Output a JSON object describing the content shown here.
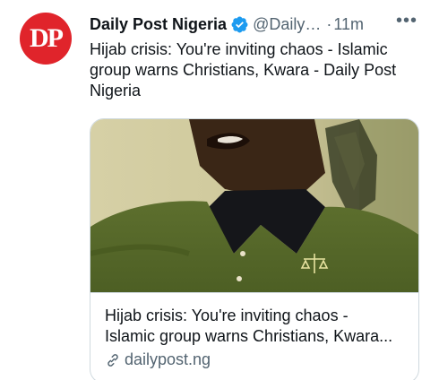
{
  "account": {
    "avatar_text": "DP",
    "display_name": "Daily Post Nigeria",
    "handle": "@Daily…",
    "separator": "·",
    "time": "11m",
    "more": "•••"
  },
  "tweet": {
    "text": "Hijab crisis: You're inviting chaos - Islamic group warns Christians, Kwara - Daily Post Nigeria"
  },
  "card": {
    "title_line1": "Hijab crisis: You're inviting chaos -",
    "title_line2": "Islamic group warns Christians, Kwara...",
    "domain": "dailypost.ng"
  },
  "colors": {
    "brand_red": "#e0242b",
    "verified_blue": "#1d9bf0",
    "secondary_text": "#536471",
    "border": "#cfd9de"
  },
  "icons": {
    "verified": "verified-badge-icon",
    "link": "link-icon",
    "more": "more-icon"
  }
}
